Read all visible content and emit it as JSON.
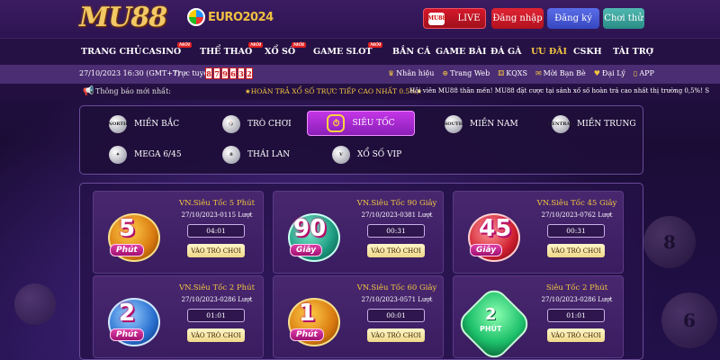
{
  "header": {
    "logo": "MU88",
    "euro_label": "EURO2024",
    "live_icon_text": "MU88",
    "live_label": "LIVE",
    "login_label": "Đăng nhập",
    "register_label": "Đăng ký",
    "trial_label": "Chơi thử"
  },
  "nav": {
    "items": [
      {
        "label": "TRANG CHỦ"
      },
      {
        "label": "CASINO",
        "badge": "MỚI"
      },
      {
        "label": "THỂ THAO",
        "badge": "MỚI"
      },
      {
        "label": "XỔ SỐ",
        "badge": "MỚI"
      },
      {
        "label": "GAME SLOT",
        "badge": "MỚI"
      },
      {
        "label": "BẮN CÁ"
      },
      {
        "label": "GAME BÀI"
      },
      {
        "label": "ĐÁ GÀ"
      },
      {
        "label": "ƯU ĐÃI"
      },
      {
        "label": "CSKH"
      },
      {
        "label": "TÀI TRỢ"
      }
    ]
  },
  "infobar": {
    "datetime": "27/10/2023 16:30 (GMT+7)",
    "online_label": "Trực tuyến:",
    "online_digits": [
      "8",
      "7",
      "9",
      "6",
      "3",
      "2"
    ],
    "links": [
      {
        "icon": "trophy-icon",
        "label": "Nhãn hiệu"
      },
      {
        "icon": "globe-icon",
        "label": "Trang Web"
      },
      {
        "icon": "dice-icon",
        "label": "KQXS"
      },
      {
        "icon": "chat-icon",
        "label": "Mời Bạn Bè"
      },
      {
        "icon": "handshake-icon",
        "label": "Đại Lý"
      },
      {
        "icon": "phone-icon",
        "label": "APP"
      }
    ]
  },
  "notice": {
    "label": "Thông báo mới nhất:",
    "text1": "★HOÀN TRẢ XỔ SỐ TRỰC TIẾP CAO NHẤT 0.5%★",
    "text2": "Hội viên MU88 thân mến! MU88 đặt cược tại sảnh xổ số hoàn trả cao nhất thị trường 0,5%! S"
  },
  "categories": {
    "items": [
      {
        "label": "MIỀN BẮC",
        "icon_text": "NORTH"
      },
      {
        "label": "TRÒ CHƠI",
        "icon_text": "🎲"
      },
      {
        "label": "SIÊU TỐC",
        "icon_text": "⏱",
        "active": true
      },
      {
        "label": "MIỀN NAM",
        "icon_text": "SOUTH"
      },
      {
        "label": "MIỀN TRUNG",
        "icon_text": "CENTRAL"
      },
      {
        "label": "MEGA 6/45",
        "icon_text": "✦"
      },
      {
        "label": "THÁI LAN",
        "icon_text": "8"
      },
      {
        "label": "XỔ SỐ VIP",
        "icon_text": "V"
      }
    ]
  },
  "games": [
    {
      "title": "VN.Siêu Tốc 5 Phút",
      "sub": "27/10/2023-0115 Lượt",
      "timer": "04:01",
      "play": "VÀO TRÒ CHƠI",
      "num": "5",
      "tag": "Phút"
    },
    {
      "title": "VN.Siêu Tốc 90 Giây",
      "sub": "27/10/2023-0381 Lượt",
      "timer": "00:31",
      "play": "VÀO TRÒ CHƠI",
      "num": "90",
      "tag": "Giây"
    },
    {
      "title": "VN.Siêu Tốc 45 Giây",
      "sub": "27/10/2023-0762 Lượt",
      "timer": "00:31",
      "play": "VÀO TRÒ CHƠI",
      "num": "45",
      "tag": "Giây"
    },
    {
      "title": "VN.Siêu Tốc 2 Phút",
      "sub": "27/10/2023-0286 Lượt",
      "timer": "01:01",
      "play": "VÀO TRÒ CHƠI",
      "num": "2",
      "tag": "Phút"
    },
    {
      "title": "VN.Siêu Tốc 60 Giây",
      "sub": "27/10/2023-0571 Lượt",
      "timer": "00:01",
      "play": "VÀO TRÒ CHƠI",
      "num": "1",
      "tag": "Phút"
    },
    {
      "title": "Siêu Tốc 2 Phút",
      "sub": "27/10/2023-0286 Lượt",
      "timer": "01:01",
      "play": "VÀO TRÒ CHƠI",
      "num": "2",
      "tag": "PHÚT"
    }
  ]
}
